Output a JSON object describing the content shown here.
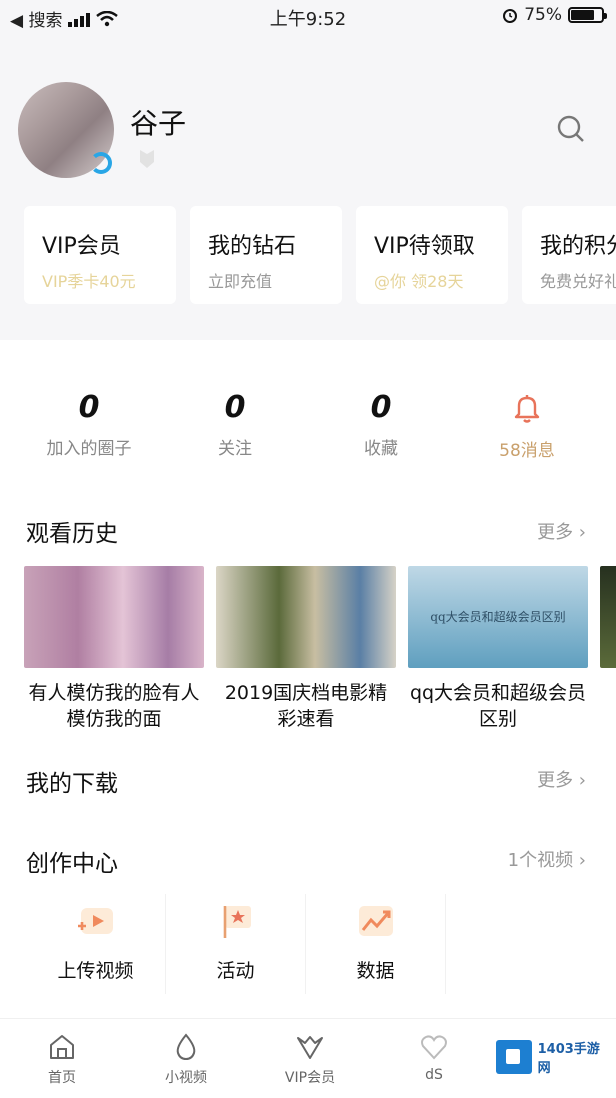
{
  "status_bar": {
    "back_label": "◀ 搜索",
    "time": "上午9:52",
    "battery": "75%",
    "battery_level": 0.75
  },
  "profile": {
    "name": "谷子"
  },
  "cards": [
    {
      "title": "VIP会员",
      "sub": "VIP季卡40元"
    },
    {
      "title": "我的钻石",
      "sub": "立即充值"
    },
    {
      "title": "VIP待领取",
      "sub": "@你 领28天"
    },
    {
      "title": "我的积分",
      "sub": "免费兑好礼"
    }
  ],
  "stats": [
    {
      "num": "0",
      "label": "加入的圈子"
    },
    {
      "num": "0",
      "label": "关注"
    },
    {
      "num": "0",
      "label": "收藏"
    },
    {
      "num": "",
      "label": "58消息"
    }
  ],
  "history": {
    "title": "观看历史",
    "more": "更多 ›",
    "items": [
      {
        "title": "有人模仿我的脸有人模仿我的面"
      },
      {
        "title": "2019国庆档电影精彩速看"
      },
      {
        "title": "qq大会员和超级会员区别",
        "thumb_text": "qq大会员和超级会员区别"
      }
    ]
  },
  "downloads": {
    "title": "我的下载",
    "more": "更多 ›"
  },
  "creator": {
    "title": "创作中心",
    "more": "1个视频 ›",
    "items": [
      {
        "label": "上传视频"
      },
      {
        "label": "活动"
      },
      {
        "label": "数据"
      }
    ]
  },
  "tabbar": [
    {
      "label": "首页"
    },
    {
      "label": "小视频"
    },
    {
      "label": "VIP会员"
    },
    {
      "label": "dS"
    }
  ],
  "watermark": {
    "text": "1403手游网"
  }
}
